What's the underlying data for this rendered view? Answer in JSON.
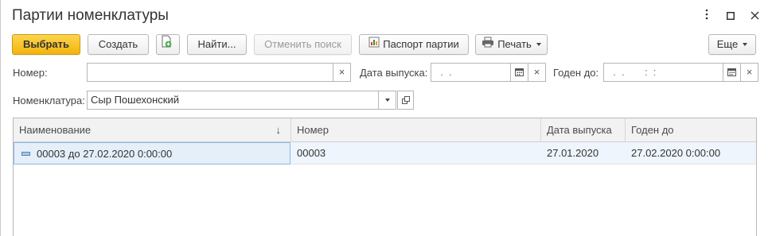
{
  "window": {
    "title": "Партии номенклатуры",
    "menu_icon": "more-vertical-icon",
    "maximize_icon": "maximize-icon",
    "close_icon": "close-icon"
  },
  "toolbar": {
    "select_label": "Выбрать",
    "create_label": "Создать",
    "copy_icon": "add-copy-icon",
    "find_label": "Найти...",
    "cancel_search_label": "Отменить поиск",
    "passport_label": "Паспорт партии",
    "passport_icon": "report-icon",
    "print_label": "Печать",
    "print_icon": "printer-icon",
    "more_label": "Еще"
  },
  "filters": {
    "number_label": "Номер:",
    "number_value": "",
    "release_date_label": "Дата выпуска:",
    "release_date_value": "  .  .",
    "valid_until_label": "Годен до:",
    "valid_until_value": "  .  .       :  :",
    "nomenclature_label": "Номенклатура:",
    "nomenclature_value": "Сыр Пошехонский",
    "clear_glyph": "×",
    "calendar_icon": "calendar-icon",
    "dropdown_icon": "chevron-down-icon",
    "open_icon": "open-link-icon"
  },
  "table": {
    "columns": [
      {
        "label": "Наименование",
        "sort": "↓"
      },
      {
        "label": "Номер"
      },
      {
        "label": "Дата выпуска"
      },
      {
        "label": "Годен до"
      }
    ],
    "rows": [
      {
        "name": "00003 до 27.02.2020 0:00:00",
        "number": "00003",
        "release_date": "27.01.2020",
        "valid_until": "27.02.2020 0:00:00"
      }
    ]
  },
  "colors": {
    "primary_button": "#f2b40c",
    "selected_row": "#eef5fc",
    "header_bg": "#f2f2f2"
  }
}
